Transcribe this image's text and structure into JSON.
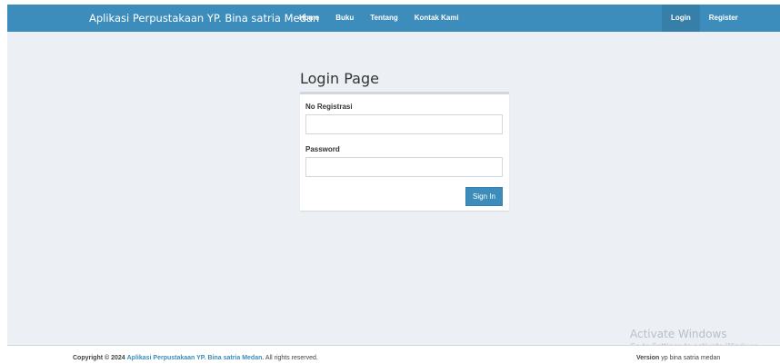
{
  "navbar": {
    "brand": "Aplikasi Perpustakaan YP. Bina satria Medan",
    "left_items": [
      "Home",
      "Buku",
      "Tentang",
      "Kontak Kami"
    ],
    "right_items": [
      "Login",
      "Register"
    ],
    "active_item": "Login",
    "color": "#3c8dbc"
  },
  "login": {
    "title": "Login Page",
    "registration_label": "No Registrasi",
    "registration_value": "",
    "password_label": "Password",
    "password_value": "",
    "submit_label": "Sign In"
  },
  "footer": {
    "copyright_prefix": "Copyright © 2024",
    "copyright_link": "Aplikasi Perpustakaan YP. Bina satria Medan.",
    "copyright_suffix": "All rights reserved.",
    "version_label": "Version",
    "version_value": "yp bina satria medan"
  },
  "watermark": {
    "title": "Activate Windows",
    "subtitle": "Go to Settings to activate Windows."
  }
}
